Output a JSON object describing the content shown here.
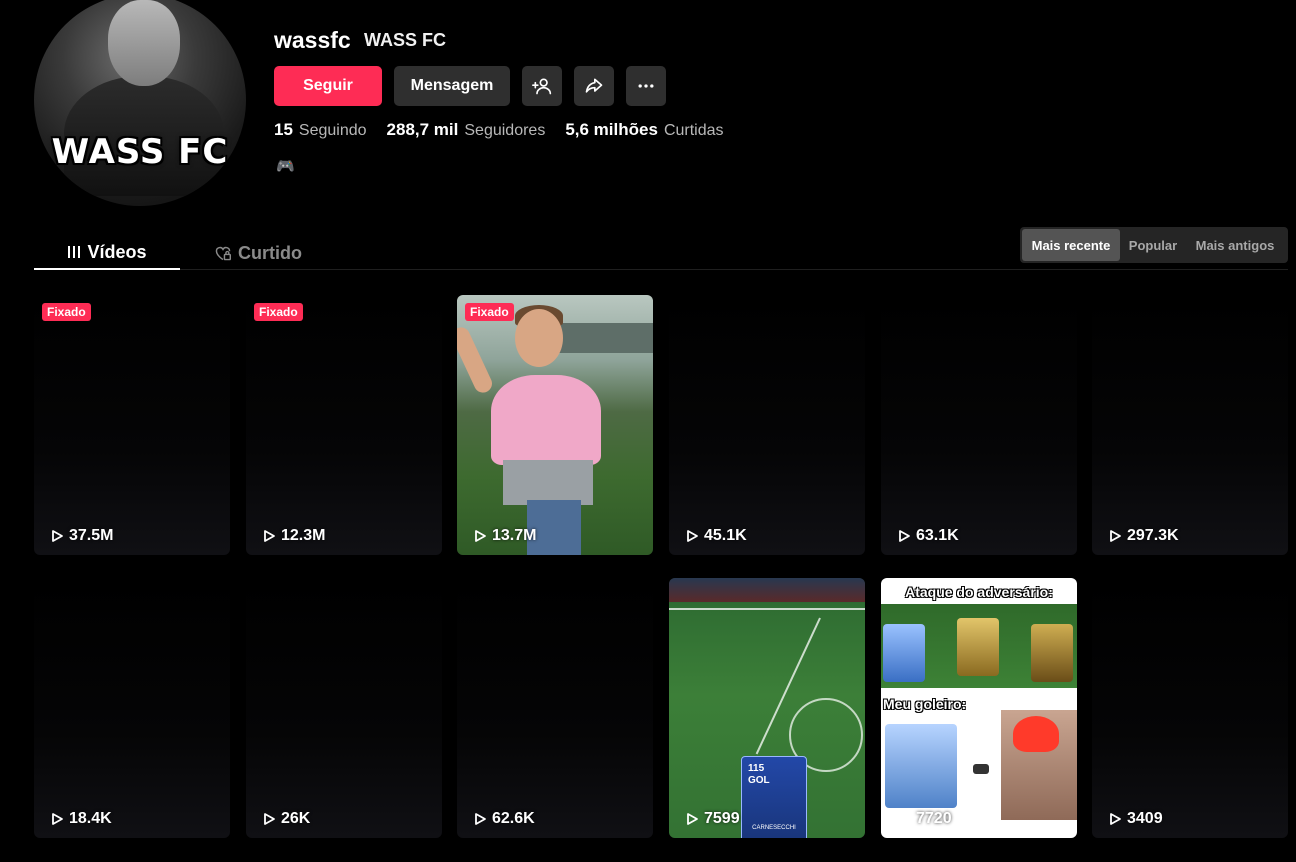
{
  "profile": {
    "avatar_text": "WASS FC",
    "username": "wassfc",
    "nickname": "WASS FC",
    "bio_emoji": "🎮"
  },
  "actions": {
    "follow_label": "Seguir",
    "message_label": "Mensagem"
  },
  "stats": {
    "following_count": "15",
    "following_label": "Seguindo",
    "followers_count": "288,7 mil",
    "followers_label": "Seguidores",
    "likes_count": "5,6 milhões",
    "likes_label": "Curtidas"
  },
  "tabs": {
    "videos": "Vídeos",
    "liked": "Curtido"
  },
  "sort": {
    "options": [
      "Mais recente",
      "Popular",
      "Mais antigos"
    ],
    "active": "Mais recente"
  },
  "colors": {
    "accent": "#fe2c55",
    "button_bg": "#2f2f2f",
    "background": "#000000"
  },
  "videos": [
    {
      "views": "37.5M",
      "pinned_label": "Fixado"
    },
    {
      "views": "12.3M",
      "pinned_label": "Fixado"
    },
    {
      "views": "13.7M",
      "pinned_label": "Fixado"
    },
    {
      "views": "45.1K"
    },
    {
      "views": "63.1K"
    },
    {
      "views": "297.3K"
    },
    {
      "views": "18.4K"
    },
    {
      "views": "26K"
    },
    {
      "views": "62.6K"
    },
    {
      "views": "7599",
      "card_rating": "115",
      "card_position": "GOL",
      "card_name": "CARNESECCHI"
    },
    {
      "views": "7720",
      "text_top": "Ataque do adversário:",
      "text_mid": "Meu goleiro:"
    },
    {
      "views": "3409"
    }
  ]
}
